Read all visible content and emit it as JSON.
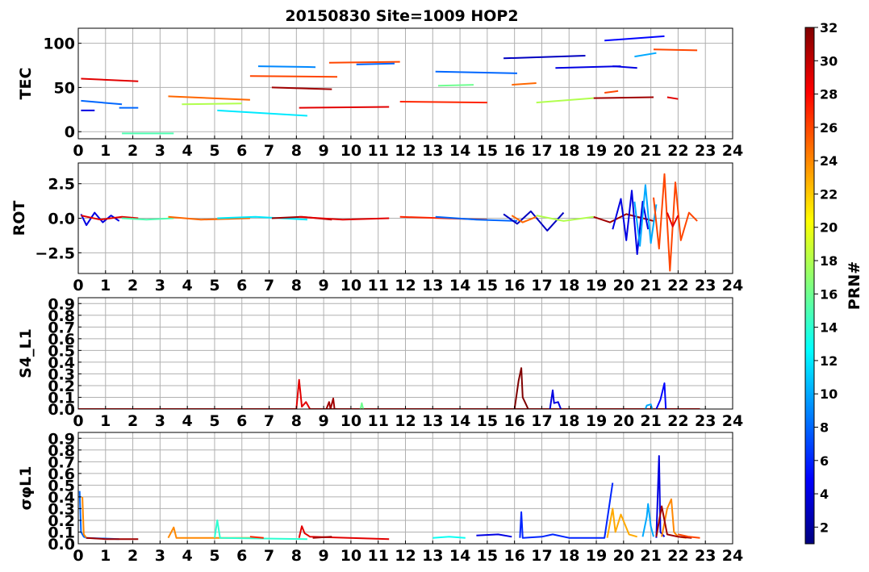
{
  "figure": {
    "title": "20150830 Site=1009 HOP2",
    "colorbar_label": "PRN#",
    "colorbar_ticks": [
      2,
      4,
      6,
      8,
      10,
      12,
      14,
      16,
      18,
      20,
      22,
      24,
      26,
      28,
      30,
      32
    ],
    "colormap": "jet",
    "prn_range": [
      1,
      32
    ]
  },
  "chart_data": [
    {
      "type": "line",
      "panel": "TEC",
      "ylabel": "TEC",
      "xlim": [
        0,
        24
      ],
      "ylim": [
        -8,
        117
      ],
      "yticks": [
        0,
        50,
        100
      ],
      "xticks": [
        0,
        1,
        2,
        3,
        4,
        5,
        6,
        7,
        8,
        9,
        10,
        11,
        12,
        13,
        14,
        15,
        16,
        17,
        18,
        19,
        20,
        21,
        22,
        23,
        24
      ],
      "grid": true,
      "series": [
        {
          "prn": 4,
          "x": [
            0.1,
            0.6
          ],
          "y": [
            24,
            24
          ]
        },
        {
          "prn": 8,
          "x": [
            0.1,
            1.6
          ],
          "y": [
            35,
            31
          ]
        },
        {
          "prn": 29,
          "x": [
            0.1,
            2.2
          ],
          "y": [
            60,
            57
          ]
        },
        {
          "prn": 8,
          "x": [
            1.5,
            2.2
          ],
          "y": [
            27,
            27
          ]
        },
        {
          "prn": 15,
          "x": [
            1.6,
            3.5
          ],
          "y": [
            -2,
            -2
          ]
        },
        {
          "prn": 25,
          "x": [
            3.3,
            6.3
          ],
          "y": [
            40,
            36
          ]
        },
        {
          "prn": 18,
          "x": [
            3.8,
            6.0
          ],
          "y": [
            31,
            32
          ]
        },
        {
          "prn": 12,
          "x": [
            5.1,
            8.4
          ],
          "y": [
            24,
            18
          ]
        },
        {
          "prn": 26,
          "x": [
            6.3,
            9.5
          ],
          "y": [
            63,
            62
          ]
        },
        {
          "prn": 9,
          "x": [
            6.6,
            8.7
          ],
          "y": [
            74,
            73
          ]
        },
        {
          "prn": 31,
          "x": [
            7.1,
            9.3
          ],
          "y": [
            50,
            48
          ]
        },
        {
          "prn": 29,
          "x": [
            8.1,
            11.4
          ],
          "y": [
            27,
            28
          ]
        },
        {
          "prn": 26,
          "x": [
            9.2,
            11.8
          ],
          "y": [
            78,
            79
          ]
        },
        {
          "prn": 8,
          "x": [
            10.2,
            11.6
          ],
          "y": [
            76,
            77
          ]
        },
        {
          "prn": 27,
          "x": [
            11.8,
            15.0
          ],
          "y": [
            34,
            33
          ]
        },
        {
          "prn": 8,
          "x": [
            13.1,
            16.1
          ],
          "y": [
            68,
            66
          ]
        },
        {
          "prn": 16,
          "x": [
            13.2,
            14.5
          ],
          "y": [
            52,
            53
          ]
        },
        {
          "prn": 25,
          "x": [
            15.9,
            16.8
          ],
          "y": [
            53,
            55
          ]
        },
        {
          "prn": 3,
          "x": [
            15.6,
            18.6
          ],
          "y": [
            83,
            86
          ]
        },
        {
          "prn": 18,
          "x": [
            16.8,
            18.9
          ],
          "y": [
            33,
            38
          ]
        },
        {
          "prn": 4,
          "x": [
            17.5,
            19.9
          ],
          "y": [
            72,
            74
          ]
        },
        {
          "prn": 31,
          "x": [
            18.9,
            21.1
          ],
          "y": [
            38,
            39
          ]
        },
        {
          "prn": 26,
          "x": [
            19.3,
            19.8
          ],
          "y": [
            44,
            46
          ]
        },
        {
          "prn": 4,
          "x": [
            19.6,
            20.5
          ],
          "y": [
            74,
            72
          ]
        },
        {
          "prn": 5,
          "x": [
            19.3,
            21.5
          ],
          "y": [
            103,
            108
          ]
        },
        {
          "prn": 10,
          "x": [
            20.4,
            21.2
          ],
          "y": [
            85,
            89
          ]
        },
        {
          "prn": 26,
          "x": [
            21.1,
            22.7
          ],
          "y": [
            93,
            92
          ]
        },
        {
          "prn": 29,
          "x": [
            21.6,
            22.0
          ],
          "y": [
            39,
            37
          ]
        }
      ]
    },
    {
      "type": "line",
      "panel": "ROT",
      "ylabel": "ROT",
      "xlim": [
        0,
        24
      ],
      "ylim": [
        -4,
        4
      ],
      "yticks": [
        -2.5,
        0.0,
        2.5
      ],
      "xticks": [
        0,
        1,
        2,
        3,
        4,
        5,
        6,
        7,
        8,
        9,
        10,
        11,
        12,
        13,
        14,
        15,
        16,
        17,
        18,
        19,
        20,
        21,
        22,
        23,
        24
      ],
      "grid": true,
      "series": [
        {
          "prn": 4,
          "x": [
            0.1,
            0.3,
            0.6,
            0.9,
            1.2,
            1.5
          ],
          "y": [
            0.3,
            -0.5,
            0.4,
            -0.3,
            0.2,
            -0.2
          ]
        },
        {
          "prn": 29,
          "x": [
            0.1,
            0.8,
            1.6,
            2.2
          ],
          "y": [
            0.2,
            -0.1,
            0.1,
            0.0
          ]
        },
        {
          "prn": 15,
          "x": [
            1.6,
            2.5,
            3.5
          ],
          "y": [
            0.0,
            -0.1,
            0.0
          ]
        },
        {
          "prn": 25,
          "x": [
            3.3,
            4.5,
            6.3
          ],
          "y": [
            0.1,
            -0.1,
            0.0
          ]
        },
        {
          "prn": 12,
          "x": [
            5.1,
            6.5,
            8.4
          ],
          "y": [
            0.0,
            0.1,
            -0.1
          ]
        },
        {
          "prn": 31,
          "x": [
            7.1,
            8.2,
            9.3
          ],
          "y": [
            0.0,
            0.1,
            -0.1
          ]
        },
        {
          "prn": 29,
          "x": [
            8.1,
            9.7,
            11.4
          ],
          "y": [
            0.1,
            -0.1,
            0.0
          ]
        },
        {
          "prn": 27,
          "x": [
            11.8,
            13.4,
            15.0
          ],
          "y": [
            0.1,
            0.0,
            -0.1
          ]
        },
        {
          "prn": 8,
          "x": [
            13.1,
            14.6,
            16.1
          ],
          "y": [
            0.1,
            -0.1,
            -0.2
          ]
        },
        {
          "prn": 3,
          "x": [
            15.6,
            16.1,
            16.6,
            17.2,
            17.8
          ],
          "y": [
            0.3,
            -0.4,
            0.5,
            -0.9,
            0.4
          ]
        },
        {
          "prn": 25,
          "x": [
            15.9,
            16.3,
            16.8
          ],
          "y": [
            0.2,
            -0.3,
            0.1
          ]
        },
        {
          "prn": 18,
          "x": [
            16.8,
            17.8,
            18.9
          ],
          "y": [
            0.2,
            -0.2,
            0.1
          ]
        },
        {
          "prn": 31,
          "x": [
            18.9,
            19.5,
            20.1,
            21.1
          ],
          "y": [
            0.1,
            -0.3,
            0.3,
            -0.2
          ]
        },
        {
          "prn": 4,
          "x": [
            19.6,
            19.9,
            20.1,
            20.3,
            20.5,
            20.7,
            20.9
          ],
          "y": [
            -0.8,
            1.4,
            -1.6,
            2.0,
            -2.6,
            1.2,
            -0.8
          ]
        },
        {
          "prn": 10,
          "x": [
            20.4,
            20.6,
            20.8,
            21.0,
            21.2
          ],
          "y": [
            1.2,
            -2.0,
            2.4,
            -1.8,
            1.0
          ]
        },
        {
          "prn": 26,
          "x": [
            21.1,
            21.3,
            21.5,
            21.7,
            21.9,
            22.1,
            22.4,
            22.7
          ],
          "y": [
            1.5,
            -2.2,
            3.2,
            -3.8,
            2.6,
            -1.6,
            0.4,
            -0.2
          ]
        },
        {
          "prn": 29,
          "x": [
            21.6,
            21.8,
            22.0
          ],
          "y": [
            0.4,
            -0.6,
            0.2
          ]
        }
      ]
    },
    {
      "type": "line",
      "panel": "S4",
      "ylabel": "S4_L1",
      "xlim": [
        0,
        24
      ],
      "ylim": [
        0.0,
        0.95
      ],
      "yticks": [
        0.0,
        0.1,
        0.2,
        0.3,
        0.4,
        0.5,
        0.6,
        0.7,
        0.8,
        0.9
      ],
      "xticks": [
        0,
        1,
        2,
        3,
        4,
        5,
        6,
        7,
        8,
        9,
        10,
        11,
        12,
        13,
        14,
        15,
        16,
        17,
        18,
        19,
        20,
        21,
        22,
        23,
        24
      ],
      "grid": true,
      "series": [
        {
          "prn": 29,
          "x": [
            0.0,
            8.0,
            8.1,
            8.2,
            8.35,
            8.5,
            9.0,
            22.8
          ],
          "y": [
            0.0,
            0.0,
            0.25,
            0.02,
            0.06,
            0.0,
            0.0,
            0.0
          ]
        },
        {
          "prn": 31,
          "x": [
            9.1,
            9.2,
            9.25,
            9.35,
            9.4,
            9.5
          ],
          "y": [
            0.0,
            0.06,
            0.0,
            0.09,
            0.0,
            0.0
          ]
        },
        {
          "prn": 16,
          "x": [
            10.35,
            10.4,
            10.45
          ],
          "y": [
            0.0,
            0.05,
            0.0
          ]
        },
        {
          "prn": 32,
          "x": [
            16.0,
            16.15,
            16.25,
            16.3,
            16.4,
            16.5
          ],
          "y": [
            0.0,
            0.24,
            0.35,
            0.1,
            0.05,
            0.0
          ]
        },
        {
          "prn": 4,
          "x": [
            17.3,
            17.4,
            17.45,
            17.6,
            17.7
          ],
          "y": [
            0.0,
            0.16,
            0.05,
            0.06,
            0.0
          ]
        },
        {
          "prn": 10,
          "x": [
            20.8,
            20.85,
            21.0,
            21.05
          ],
          "y": [
            0.0,
            0.03,
            0.04,
            0.0
          ]
        },
        {
          "prn": 5,
          "x": [
            21.2,
            21.35,
            21.5,
            21.55
          ],
          "y": [
            0.0,
            0.08,
            0.22,
            0.0
          ]
        }
      ]
    },
    {
      "type": "line",
      "panel": "sigma_phi",
      "ylabel": "σφL1",
      "xlim": [
        0,
        24
      ],
      "ylim": [
        0.0,
        0.95
      ],
      "yticks": [
        0.0,
        0.1,
        0.2,
        0.3,
        0.4,
        0.5,
        0.6,
        0.7,
        0.8,
        0.9
      ],
      "xticks": [
        0,
        1,
        2,
        3,
        4,
        5,
        6,
        7,
        8,
        9,
        10,
        11,
        12,
        13,
        14,
        15,
        16,
        17,
        18,
        19,
        20,
        21,
        22,
        23,
        24
      ],
      "grid": true,
      "series": [
        {
          "prn": 8,
          "x": [
            0.05,
            0.1,
            0.2,
            0.3,
            1.5
          ],
          "y": [
            0.45,
            0.1,
            0.06,
            0.05,
            0.04
          ]
        },
        {
          "prn": 24,
          "x": [
            0.15,
            0.2,
            0.3
          ],
          "y": [
            0.4,
            0.08,
            0.05
          ]
        },
        {
          "prn": 31,
          "x": [
            0.3,
            1.0,
            2.2
          ],
          "y": [
            0.05,
            0.04,
            0.04
          ]
        },
        {
          "prn": 24,
          "x": [
            3.3,
            3.5,
            3.6,
            6.3
          ],
          "y": [
            0.05,
            0.14,
            0.05,
            0.05
          ]
        },
        {
          "prn": 14,
          "x": [
            5.0,
            5.1,
            5.2,
            8.4
          ],
          "y": [
            0.05,
            0.2,
            0.05,
            0.04
          ]
        },
        {
          "prn": 27,
          "x": [
            6.3,
            6.8
          ],
          "y": [
            0.06,
            0.05
          ]
        },
        {
          "prn": 29,
          "x": [
            8.1,
            8.2,
            8.3,
            8.5,
            11.4
          ],
          "y": [
            0.05,
            0.15,
            0.09,
            0.06,
            0.04
          ]
        },
        {
          "prn": 31,
          "x": [
            8.6,
            9.3
          ],
          "y": [
            0.05,
            0.06
          ]
        },
        {
          "prn": 13,
          "x": [
            13.0,
            13.6,
            14.2
          ],
          "y": [
            0.05,
            0.06,
            0.05
          ]
        },
        {
          "prn": 4,
          "x": [
            14.6,
            15.4,
            15.9
          ],
          "y": [
            0.07,
            0.08,
            0.06
          ]
        },
        {
          "prn": 6,
          "x": [
            16.2,
            16.25,
            16.3,
            17.0,
            17.4,
            18.0,
            19.3,
            19.6
          ],
          "y": [
            0.05,
            0.27,
            0.05,
            0.06,
            0.08,
            0.05,
            0.05,
            0.52
          ]
        },
        {
          "prn": 23,
          "x": [
            19.4,
            19.6,
            19.7,
            19.9,
            20.2,
            20.5
          ],
          "y": [
            0.05,
            0.3,
            0.1,
            0.25,
            0.08,
            0.06
          ]
        },
        {
          "prn": 10,
          "x": [
            20.7,
            20.85,
            20.9,
            21.0,
            21.1
          ],
          "y": [
            0.06,
            0.23,
            0.34,
            0.15,
            0.06
          ]
        },
        {
          "prn": 4,
          "x": [
            21.2,
            21.3,
            21.35,
            21.5
          ],
          "y": [
            0.05,
            0.75,
            0.1,
            0.06
          ]
        },
        {
          "prn": 24,
          "x": [
            21.4,
            21.6,
            21.75,
            21.85,
            22.0,
            22.3
          ],
          "y": [
            0.06,
            0.3,
            0.38,
            0.1,
            0.06,
            0.05
          ]
        },
        {
          "prn": 31,
          "x": [
            21.2,
            21.4,
            21.6,
            22.0,
            22.5
          ],
          "y": [
            0.06,
            0.32,
            0.08,
            0.06,
            0.05
          ]
        },
        {
          "prn": 26,
          "x": [
            22.0,
            22.4,
            22.8
          ],
          "y": [
            0.08,
            0.06,
            0.05
          ]
        }
      ]
    }
  ]
}
